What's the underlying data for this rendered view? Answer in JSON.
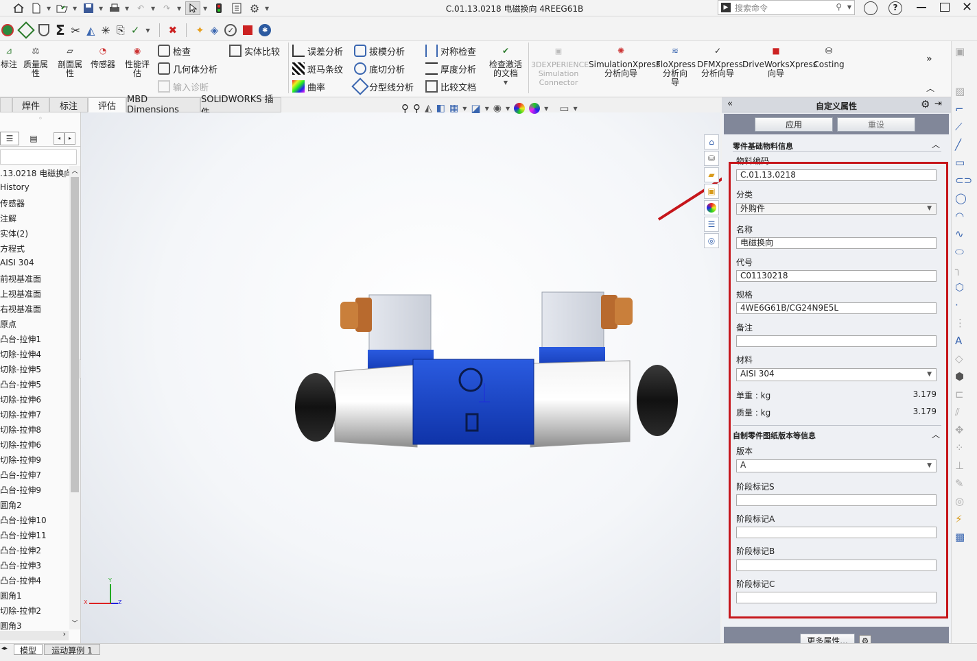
{
  "window": {
    "title": "C.01.13.0218 电磁换向 4REEG61B",
    "search_placeholder": "搜索命令"
  },
  "ribbon": {
    "big_buttons": [
      {
        "label": "标注",
        "icon": "dimension-icon"
      },
      {
        "label": "质量属\n性",
        "icon": "mass-properties-icon"
      },
      {
        "label": "剖面属\n性",
        "icon": "section-properties-icon"
      },
      {
        "label": "传感器",
        "icon": "sensor-icon"
      },
      {
        "label": "性能评\n估",
        "icon": "performance-icon"
      }
    ],
    "col1": [
      "检查",
      "几何体分析",
      "输入诊断"
    ],
    "col2": [
      "实体比较"
    ],
    "col3": [
      "误差分析",
      "斑马条纹",
      "曲率"
    ],
    "col4": [
      "拔模分析",
      "底切分析",
      "分型线分析"
    ],
    "col5": [
      "对称检查",
      "厚度分析",
      "比较文档"
    ],
    "check_active": "检查激活\n的文档",
    "addins": [
      {
        "label": "3DEXPERIENCE\nSimulation\nConnector",
        "disabled": true
      },
      {
        "label": "SimulationXpress\n分析向导",
        "disabled": false
      },
      {
        "label": "FloXpress\n分析向\n导",
        "disabled": false
      },
      {
        "label": "DFMXpress\n分析向导",
        "disabled": false
      },
      {
        "label": "DriveWorksXpress\n向导",
        "disabled": false
      },
      {
        "label": "Costing",
        "disabled": false
      }
    ]
  },
  "tabs": [
    {
      "label": "焊件"
    },
    {
      "label": "标注"
    },
    {
      "label": "评估",
      "active": true
    },
    {
      "label": "MBD Dimensions"
    },
    {
      "label": "SOLIDWORKS 插件"
    }
  ],
  "tree": {
    "root": ".13.0218 电磁换向",
    "items": [
      "History",
      "传感器",
      "注解",
      "实体(2)",
      "方程式",
      "AISI 304",
      "前视基准面",
      "上视基准面",
      "右视基准面",
      "原点",
      "凸台-拉伸1",
      "切除-拉伸4",
      "切除-拉伸5",
      "凸台-拉伸5",
      "切除-拉伸6",
      "切除-拉伸7",
      "切除-拉伸8",
      "切除-拉伸6",
      "切除-拉伸9",
      "凸台-拉伸7",
      "凸台-拉伸9",
      "圆角2",
      "凸台-拉伸10",
      "凸台-拉伸11",
      "凸台-拉伸2",
      "凸台-拉伸3",
      "凸台-拉伸4",
      "圆角1",
      "切除-拉伸2",
      "圆角3"
    ]
  },
  "bottom_tabs": {
    "model": "模型",
    "motion": "运动算例 1"
  },
  "triad": {
    "x": "X",
    "y": "Y",
    "z": "Z"
  },
  "custom_props": {
    "panel_title": "自定义属性",
    "apply": "应用",
    "reset": "重设",
    "section1": "零件基础物料信息",
    "material_code_label": "物料编码",
    "material_code": "C.01.13.0218",
    "category_label": "分类",
    "category": "外购件",
    "name_label": "名称",
    "name": "电磁换向",
    "code_label": "代号",
    "code": "C01130218",
    "spec_label": "规格",
    "spec": "4WE6G61B/CG24N9E5L",
    "note_label": "备注",
    "note": "",
    "material_label": "材料",
    "material": "AISI 304",
    "unit_weight_label": "单重 : kg",
    "unit_weight": "3.179",
    "mass_label": "质量 : kg",
    "mass": "3.179",
    "section2": "自制零件图纸版本等信息",
    "version_label": "版本",
    "version": "A",
    "stageS_label": "阶段标记S",
    "stageA_label": "阶段标记A",
    "stageB_label": "阶段标记B",
    "stageC_label": "阶段标记C",
    "more": "更多属性..."
  },
  "colors": {
    "accent_red": "#c6161b",
    "valve_blue": "#1848c8"
  }
}
